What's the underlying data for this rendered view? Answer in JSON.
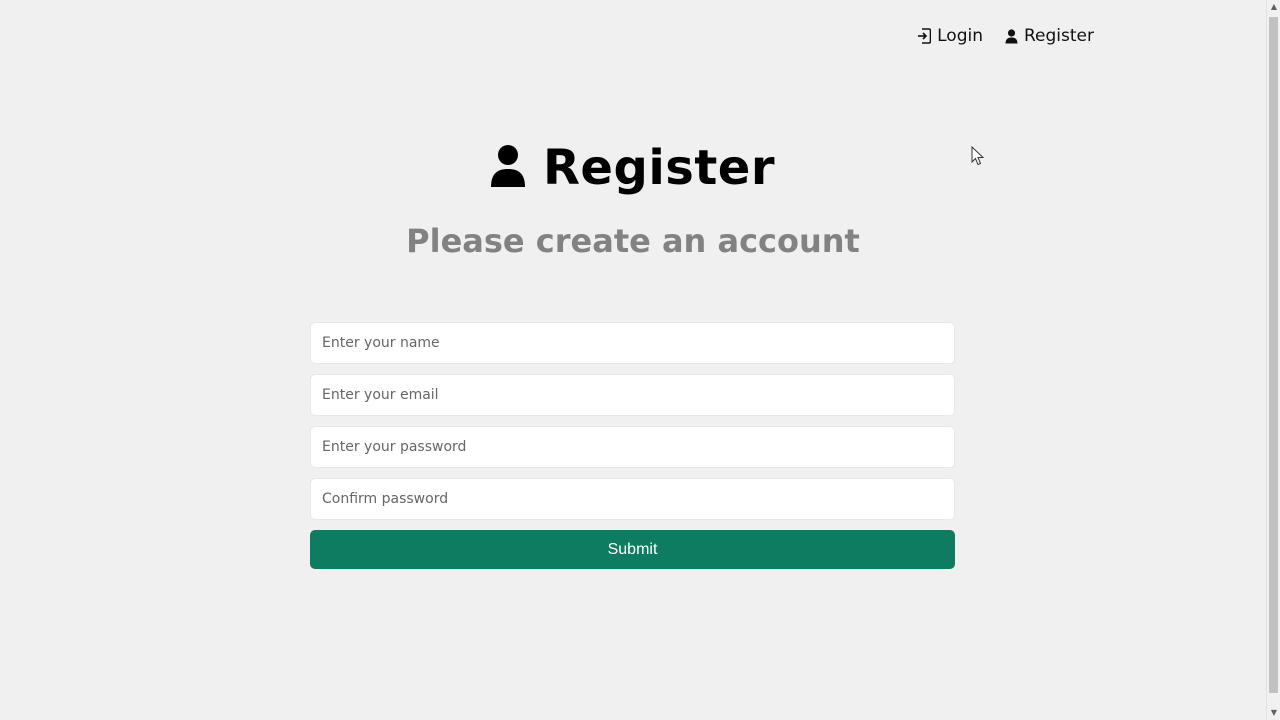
{
  "nav": {
    "login_label": "Login",
    "login_icon": "sign-in-icon",
    "register_label": "Register",
    "register_icon": "user-icon"
  },
  "heading": {
    "title": "Register",
    "icon": "user-icon"
  },
  "subheading": "Please create an account",
  "form": {
    "name_placeholder": "Enter your name",
    "name_value": "",
    "email_placeholder": "Enter your email",
    "email_value": "",
    "password_placeholder": "Enter your password",
    "password_value": "",
    "confirm_placeholder": "Confirm password",
    "confirm_value": "",
    "submit_label": "Submit"
  },
  "colors": {
    "background": "#f0f0f0",
    "accent": "#0e7c61",
    "subheading": "#828282",
    "text": "#111111"
  }
}
